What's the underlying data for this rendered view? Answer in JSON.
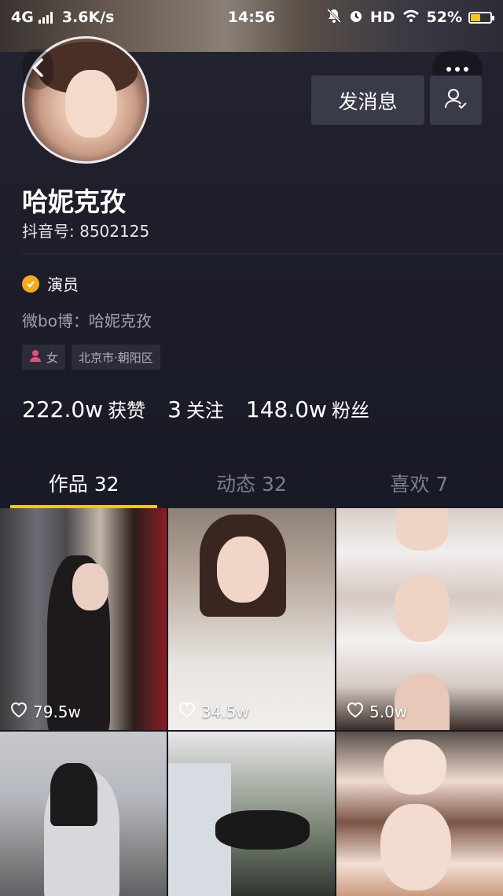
{
  "status_bar": {
    "network": "4G",
    "speed": "3.6K/s",
    "time": "14:56",
    "hd": "HD",
    "battery_percent": "52%",
    "battery_level": 0.52
  },
  "profile": {
    "name": "哈妮克孜",
    "douyin_id": "抖音号: 8502125",
    "verify_label": "演员",
    "weibo": "微bo博：哈妮克孜",
    "gender_tag": "女",
    "location_tag": "北京市·朝阳区"
  },
  "actions": {
    "message_label": "发消息"
  },
  "stats": {
    "likes_num": "222.0w",
    "likes_label": "获赞",
    "following_num": "3",
    "following_label": "关注",
    "fans_num": "148.0w",
    "fans_label": "粉丝"
  },
  "tabs": [
    {
      "label": "作品 32",
      "active": true
    },
    {
      "label": "动态 32",
      "active": false
    },
    {
      "label": "喜欢 7",
      "active": false
    }
  ],
  "videos": [
    {
      "likes": "79.5w"
    },
    {
      "likes": "34.5w"
    },
    {
      "likes": "5.0w"
    },
    {
      "likes": ""
    },
    {
      "likes": ""
    },
    {
      "likes": ""
    }
  ],
  "colors": {
    "background": "#161823",
    "accent": "#f5c518",
    "verify_badge": "#f4a81d",
    "button_bg": "#3a3b48",
    "female_icon": "#e0527a"
  }
}
